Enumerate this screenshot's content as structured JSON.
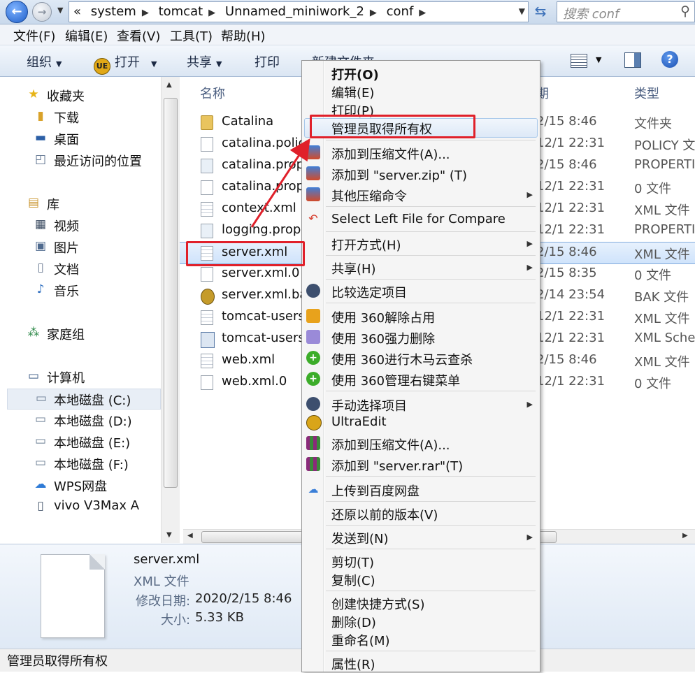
{
  "address": {
    "breadcrumbs": [
      "«",
      "system",
      "tomcat",
      "Unnamed_miniwork_2",
      "conf"
    ],
    "search_placeholder": "搜索 conf"
  },
  "menubar": [
    "文件(F)",
    "编辑(E)",
    "查看(V)",
    "工具(T)",
    "帮助(H)"
  ],
  "toolbar": {
    "organize": "组织",
    "open": "打开",
    "share": "共享",
    "print": "打印",
    "new_folder": "新建文件夹",
    "ue_icon_text": "UE"
  },
  "nav": {
    "favorites": "收藏夹",
    "downloads": "下载",
    "desktop": "桌面",
    "recent": "最近访问的位置",
    "libraries": "库",
    "videos": "视频",
    "pictures": "图片",
    "documents": "文档",
    "music": "音乐",
    "homegroup": "家庭组",
    "computer": "计算机",
    "drive_c": "本地磁盘 (C:)",
    "drive_d": "本地磁盘 (D:)",
    "drive_e": "本地磁盘 (E:)",
    "drive_f": "本地磁盘 (F:)",
    "wps": "WPS网盘",
    "vivo": "vivo V3Max A"
  },
  "columns": {
    "name": "名称",
    "date": "期",
    "type": "类型"
  },
  "files": [
    {
      "name": "Catalina",
      "date": "2/15 8:46",
      "type": "文件夹",
      "icon": "folder-icon"
    },
    {
      "name": "catalina.polic",
      "date": "12/1 22:31",
      "type": "POLICY 文",
      "icon": "document-icon"
    },
    {
      "name": "catalina.prop",
      "date": "2/15 8:46",
      "type": "PROPERTI",
      "icon": "properties-file-icon"
    },
    {
      "name": "catalina.prop",
      "date": "12/1 22:31",
      "type": "0 文件",
      "icon": "document-icon"
    },
    {
      "name": "context.xml",
      "date": "12/1 22:31",
      "type": "XML 文件",
      "icon": "xml-file-icon"
    },
    {
      "name": "logging.prop",
      "date": "12/1 22:31",
      "type": "PROPERTI",
      "icon": "properties-file-icon"
    },
    {
      "name": "server.xml",
      "date": "2/15 8:46",
      "type": "XML 文件",
      "icon": "xml-file-icon"
    },
    {
      "name": "server.xml.0",
      "date": "2/15 8:35",
      "type": "0 文件",
      "icon": "document-icon"
    },
    {
      "name": "server.xml.ba",
      "date": "2/14 23:54",
      "type": "BAK 文件",
      "icon": "bak-file-icon"
    },
    {
      "name": "tomcat-users",
      "date": "12/1 22:31",
      "type": "XML 文件",
      "icon": "xml-file-icon"
    },
    {
      "name": "tomcat-users",
      "date": "12/1 22:31",
      "type": "XML Scher",
      "icon": "schema-file-icon"
    },
    {
      "name": "web.xml",
      "date": "2/15 8:46",
      "type": "XML 文件",
      "icon": "xml-file-icon"
    },
    {
      "name": "web.xml.0",
      "date": "12/1 22:31",
      "type": "0 文件",
      "icon": "document-icon"
    }
  ],
  "details": {
    "filename": "server.xml",
    "filetype": "XML 文件",
    "modified_label": "修改日期:",
    "modified_value": "2020/2/15 8:46",
    "size_label": "大小:",
    "size_value": "5.33 KB"
  },
  "statusbar": "管理员取得所有权",
  "context_menu": {
    "open": "打开(O)",
    "edit": "编辑(E)",
    "print": "打印(P)",
    "take_ownership": "管理员取得所有权",
    "add_to_archive": "添加到压缩文件(A)...",
    "add_to_zip": "添加到 \"server.zip\" (T)",
    "other_compress": "其他压缩命令",
    "compare": "Select Left File for Compare",
    "open_with": "打开方式(H)",
    "share": "共享(H)",
    "compare_selected": "比较选定项目",
    "unlock_360": "使用 360解除占用",
    "force_delete_360": "使用 360强力删除",
    "scan_360": "使用 360进行木马云查杀",
    "manage_menu_360": "使用 360管理右键菜单",
    "manual_select": "手动选择项目",
    "ultraedit": "UltraEdit",
    "add_to_archive2": "添加到压缩文件(A)...",
    "add_to_rar": "添加到 \"server.rar\"(T)",
    "baidu_upload": "上传到百度网盘",
    "restore_previous": "还原以前的版本(V)",
    "send_to": "发送到(N)",
    "cut": "剪切(T)",
    "copy": "复制(C)",
    "create_shortcut": "创建快捷方式(S)",
    "delete": "删除(D)",
    "rename": "重命名(M)",
    "properties": "属性(R)"
  },
  "colors": {
    "annotation_red": "#e0202a",
    "selection_blue": "#cfe3fb"
  }
}
